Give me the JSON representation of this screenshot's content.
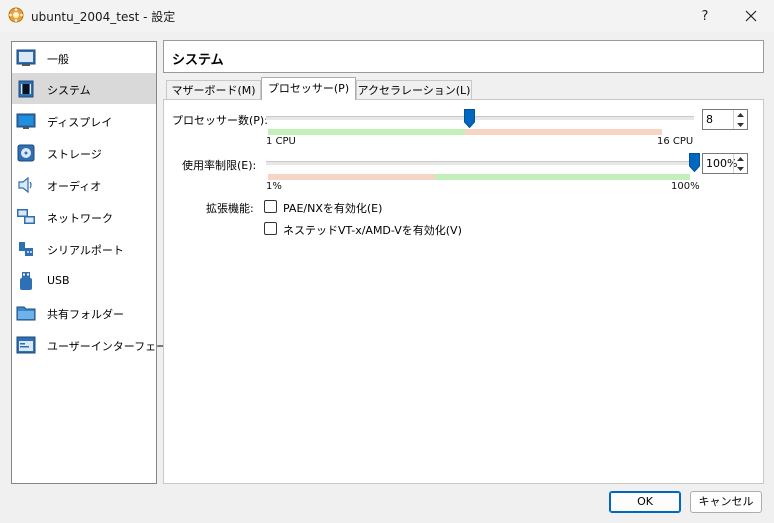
{
  "window": {
    "title": "ubuntu_2004_test - 設定",
    "help_label": "?"
  },
  "sidebar": {
    "items": [
      {
        "label": "一般",
        "icon": "general-icon"
      },
      {
        "label": "システム",
        "icon": "system-icon",
        "selected": true
      },
      {
        "label": "ディスプレイ",
        "icon": "display-icon"
      },
      {
        "label": "ストレージ",
        "icon": "storage-icon"
      },
      {
        "label": "オーディオ",
        "icon": "audio-icon"
      },
      {
        "label": "ネットワーク",
        "icon": "network-icon"
      },
      {
        "label": "シリアルポート",
        "icon": "serial-port-icon"
      },
      {
        "label": "USB",
        "icon": "usb-icon"
      },
      {
        "label": "共有フォルダー",
        "icon": "shared-folder-icon"
      },
      {
        "label": "ユーザーインターフェース",
        "icon": "user-interface-icon"
      }
    ]
  },
  "page": {
    "title": "システム"
  },
  "tabs": [
    {
      "label": "マザーボード(M)",
      "active": false
    },
    {
      "label": "プロセッサー(P)",
      "active": true
    },
    {
      "label": "アクセラレーション(L)",
      "active": false
    }
  ],
  "processor": {
    "cpu_label": "プロセッサー数(P):",
    "cpu_value": "8",
    "cpu_min_label": "1 CPU",
    "cpu_max_label": "16 CPU",
    "cpu_min": 1,
    "cpu_max": 16,
    "cpu_count": 8,
    "cap_label": "使用率制限(E):",
    "cap_value": "100%",
    "cap_min_label": "1%",
    "cap_max_label": "100%",
    "cap_percent": 100,
    "features_label": "拡張機能:",
    "pae_label": "PAE/NXを有効化(E)",
    "pae_checked": false,
    "nested_label": "ネステッドVT-x/AMD-Vを有効化(V)",
    "nested_checked": false
  },
  "footer": {
    "ok_label": "OK",
    "cancel_label": "キャンセル"
  },
  "colors": {
    "accent": "#0067c0",
    "slider_green": "#c3f0b9",
    "slider_red": "#f7d4c5",
    "selected_item": "#d9d9d9"
  }
}
